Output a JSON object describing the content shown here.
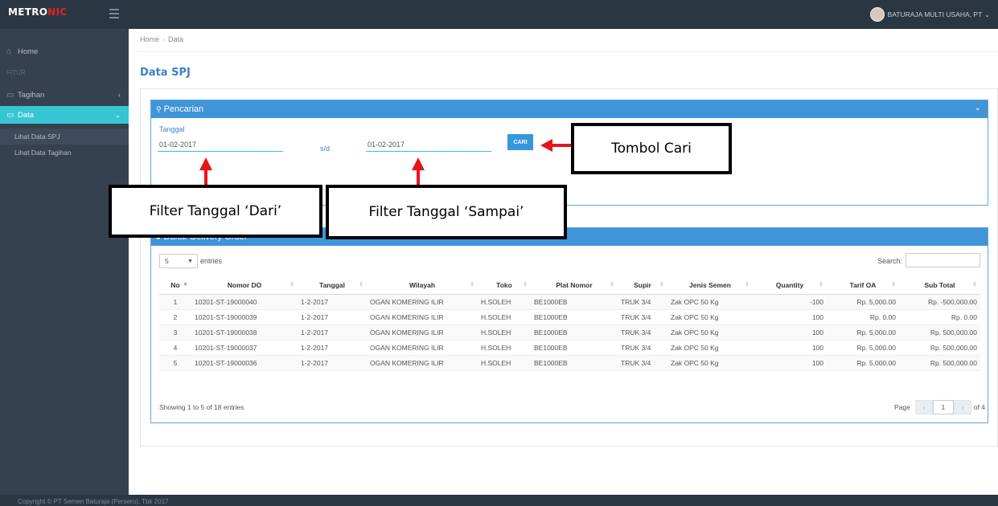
{
  "brand": {
    "part1": "METRO",
    "part2": "NIC"
  },
  "user": {
    "name": "BATURAJA MULTI USAHA, PT",
    "caret": "⌄"
  },
  "sidebar": {
    "home": {
      "icon": "home-icon",
      "glyph": "⌂",
      "label": "Home"
    },
    "section": "FITUR",
    "tagihan": {
      "icon": "card-icon",
      "glyph": "▭",
      "label": "Tagihan",
      "arrow": "‹"
    },
    "data": {
      "icon": "monitor-icon",
      "glyph": "▭",
      "label": "Data",
      "arrow": "⌄"
    },
    "sub": [
      "Lihat Data SPJ",
      "Lihat Data Tagihan"
    ]
  },
  "footer": "Copyright © PT Semen Baturaja (Persero), Tbk 2017",
  "breadcrumb": {
    "home": "Home",
    "sep": "›",
    "current": "Data"
  },
  "page_title": "Data SPJ",
  "search_panel": {
    "title": "Pencarian",
    "search_glyph": "🔍",
    "chevron": "⌄",
    "date_label": "Tanggal",
    "date_from": "01-02-2017",
    "sd": "s/d",
    "date_to": "01-02-2017",
    "button": "CARI"
  },
  "table_panel": {
    "title": "Daftar Delivery Order",
    "entries_value": "5",
    "entries_text": "entries",
    "search_label": "Search:",
    "columns": [
      "No",
      "Nomor DO",
      "Tanggal",
      "Wilayah",
      "Toko",
      "Plat Nomor",
      "Supir",
      "Jenis Semen",
      "Quantity",
      "Tarif OA",
      "Sub Total"
    ],
    "rows": [
      [
        "1",
        "10201-ST-19000040",
        "1-2-2017",
        "OGAN KOMERING ILIR",
        "H.SOLEH",
        "BE1000EB",
        "TRUK 3/4",
        "Zak OPC 50 Kg",
        "-100",
        "Rp. 5,000.00",
        "Rp. -500,000.00"
      ],
      [
        "2",
        "10201-ST-19000039",
        "1-2-2017",
        "OGAN KOMERING ILIR",
        "H.SOLEH",
        "BE1000EB",
        "TRUK 3/4",
        "Zak OPC 50 Kg",
        "100",
        "Rp. 0.00",
        "Rp. 0.00"
      ],
      [
        "3",
        "10201-ST-19000038",
        "1-2-2017",
        "OGAN KOMERING ILIR",
        "H.SOLEH",
        "BE1000EB",
        "TRUK 3/4",
        "Zak OPC 50 Kg",
        "100",
        "Rp. 5,000.00",
        "Rp. 500,000.00"
      ],
      [
        "4",
        "10201-ST-19000037",
        "1-2-2017",
        "OGAN KOMERING ILIR",
        "H.SOLEH",
        "BE1000EB",
        "TRUK 3/4",
        "Zak OPC 50 Kg",
        "100",
        "Rp. 5,000.00",
        "Rp. 500,000.00"
      ],
      [
        "5",
        "10201-ST-19000036",
        "1-2-2017",
        "OGAN KOMERING ILIR",
        "H.SOLEH",
        "BE1000EB",
        "TRUK 3/4",
        "Zak OPC 50 Kg",
        "100",
        "Rp. 5,000.00",
        "Rp. 500,000.00"
      ]
    ],
    "showing": "Showing 1 to 5 of 18 entries",
    "pager": {
      "page_label": "Page",
      "prev": "‹",
      "current": "1",
      "next": "›",
      "of": "of 4"
    }
  },
  "annotations": {
    "cari": "Tombol Cari",
    "dari": "Filter Tanggal ‘Dari’",
    "sampai": "Filter Tanggal ‘Sampai’"
  },
  "colors": {
    "accent": "#36c6d3",
    "panel_head": "#4094d8",
    "topbar": "#2b3643",
    "sidebar": "#364150",
    "arrow": "#e8141b"
  }
}
